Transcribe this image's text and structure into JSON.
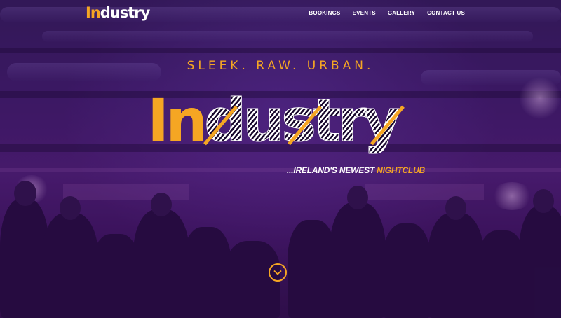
{
  "brand": {
    "logo_prefix": "In",
    "logo_suffix": "dustry",
    "accent_color": "#f5a623"
  },
  "nav": {
    "items": [
      {
        "label": "BOOKINGS"
      },
      {
        "label": "EVENTS"
      },
      {
        "label": "GALLERY"
      },
      {
        "label": "CONTACT US"
      }
    ]
  },
  "hero": {
    "tagline": "SLEEK. RAW. URBAN.",
    "big_logo_prefix": "In",
    "big_logo_suffix": "dustry",
    "subtitle_main": "...IRELAND'S NEWEST ",
    "subtitle_accent": "NIGHTCLUB",
    "scroll_icon": "chevron-down-icon"
  }
}
